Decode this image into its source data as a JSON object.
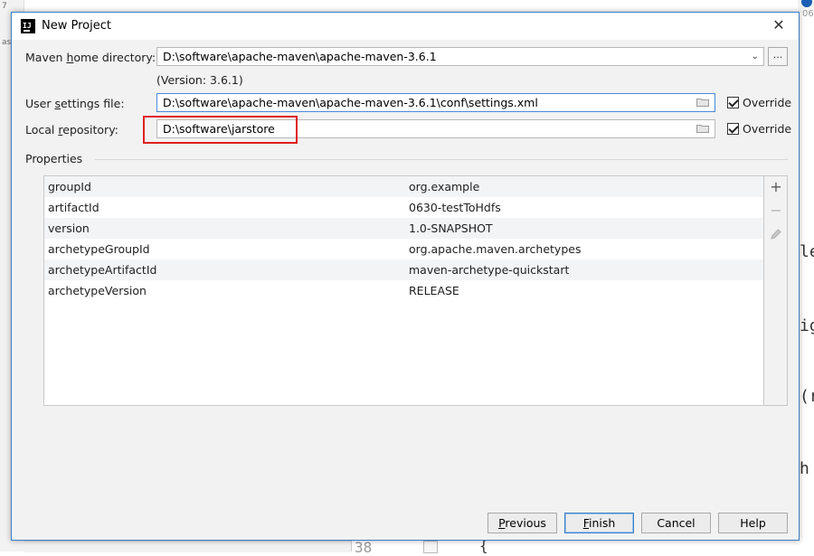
{
  "dialog": {
    "title": "New Project",
    "close_glyph": "✕"
  },
  "maven_home": {
    "label_pre": "Maven ",
    "label_mnemonic": "h",
    "label_post": "ome directory:",
    "value": "D:\\software\\apache-maven\\apache-maven-3.6.1",
    "version": "(Version: 3.6.1)",
    "browse_label": "..."
  },
  "user_settings": {
    "label_pre": "User ",
    "label_mnemonic": "s",
    "label_post": "ettings file:",
    "value": "D:\\software\\apache-maven\\apache-maven-3.6.1\\conf\\settings.xml",
    "override_label": "Override",
    "override_checked": true
  },
  "local_repo": {
    "label_pre": "Local ",
    "label_mnemonic": "r",
    "label_post": "epository:",
    "value": "D:\\software\\jarstore",
    "override_label": "Override",
    "override_checked": true
  },
  "properties": {
    "title": "Properties",
    "rows": [
      {
        "key": "groupId",
        "value": "org.example"
      },
      {
        "key": "artifactId",
        "value": "0630-testToHdfs"
      },
      {
        "key": "version",
        "value": "1.0-SNAPSHOT"
      },
      {
        "key": "archetypeGroupId",
        "value": "org.apache.maven.archetypes"
      },
      {
        "key": "archetypeArtifactId",
        "value": "maven-archetype-quickstart"
      },
      {
        "key": "archetypeVersion",
        "value": "RELEASE"
      }
    ]
  },
  "buttons": {
    "previous": {
      "mnemonic": "P",
      "rest": "revious"
    },
    "finish": {
      "mnemonic": "F",
      "rest": "inish"
    },
    "cancel": "Cancel",
    "help": "Help"
  },
  "background": {
    "top_number": "06",
    "code_chars": [
      "le",
      "ig",
      "(r",
      "h"
    ],
    "left_chars": [
      "7",
      "as"
    ],
    "gutter_number": "38",
    "brace": "{"
  },
  "colors": {
    "accent": "#3c7fc5",
    "highlight": "#e02020"
  }
}
